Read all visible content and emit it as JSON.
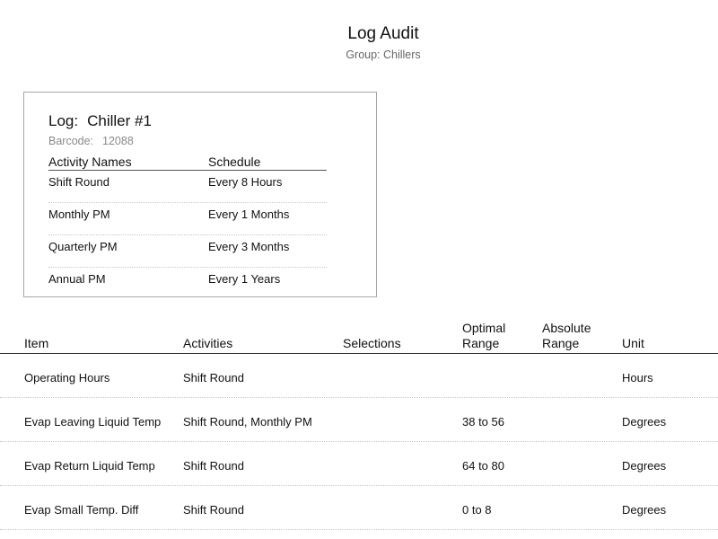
{
  "header": {
    "title": "Log Audit",
    "subtitle": "Group: Chillers"
  },
  "log": {
    "label": "Log:",
    "name": "Chiller #1",
    "barcode_label": "Barcode:",
    "barcode": "12088",
    "columns": [
      "Activity Names",
      "Schedule"
    ],
    "activities": [
      {
        "name": "Shift Round",
        "schedule": "Every 8 Hours"
      },
      {
        "name": "Monthly PM",
        "schedule": "Every 1 Months"
      },
      {
        "name": "Quarterly PM",
        "schedule": "Every 3 Months"
      },
      {
        "name": "Annual PM",
        "schedule": "Every 1 Years"
      }
    ]
  },
  "items_table": {
    "columns": [
      {
        "line1": "",
        "line2": "Item"
      },
      {
        "line1": "",
        "line2": "Activities"
      },
      {
        "line1": "",
        "line2": "Selections"
      },
      {
        "line1": "Optimal",
        "line2": "Range"
      },
      {
        "line1": "Absolute",
        "line2": "Range"
      },
      {
        "line1": "",
        "line2": "Unit"
      }
    ],
    "rows": [
      {
        "item": "Operating Hours",
        "activities": "Shift Round",
        "selections": "",
        "optimal_range": "",
        "absolute_range": "",
        "unit": "Hours"
      },
      {
        "item": "Evap Leaving Liquid Temp",
        "activities": "Shift Round, Monthly PM",
        "selections": "",
        "optimal_range": "38 to 56",
        "absolute_range": "",
        "unit": "Degrees"
      },
      {
        "item": "Evap Return Liquid Temp",
        "activities": "Shift Round",
        "selections": "",
        "optimal_range": "64 to 80",
        "absolute_range": "",
        "unit": "Degrees"
      },
      {
        "item": "Evap Small Temp. Diff",
        "activities": "Shift Round",
        "selections": "",
        "optimal_range": "0 to 8",
        "absolute_range": "",
        "unit": "Degrees"
      }
    ]
  }
}
